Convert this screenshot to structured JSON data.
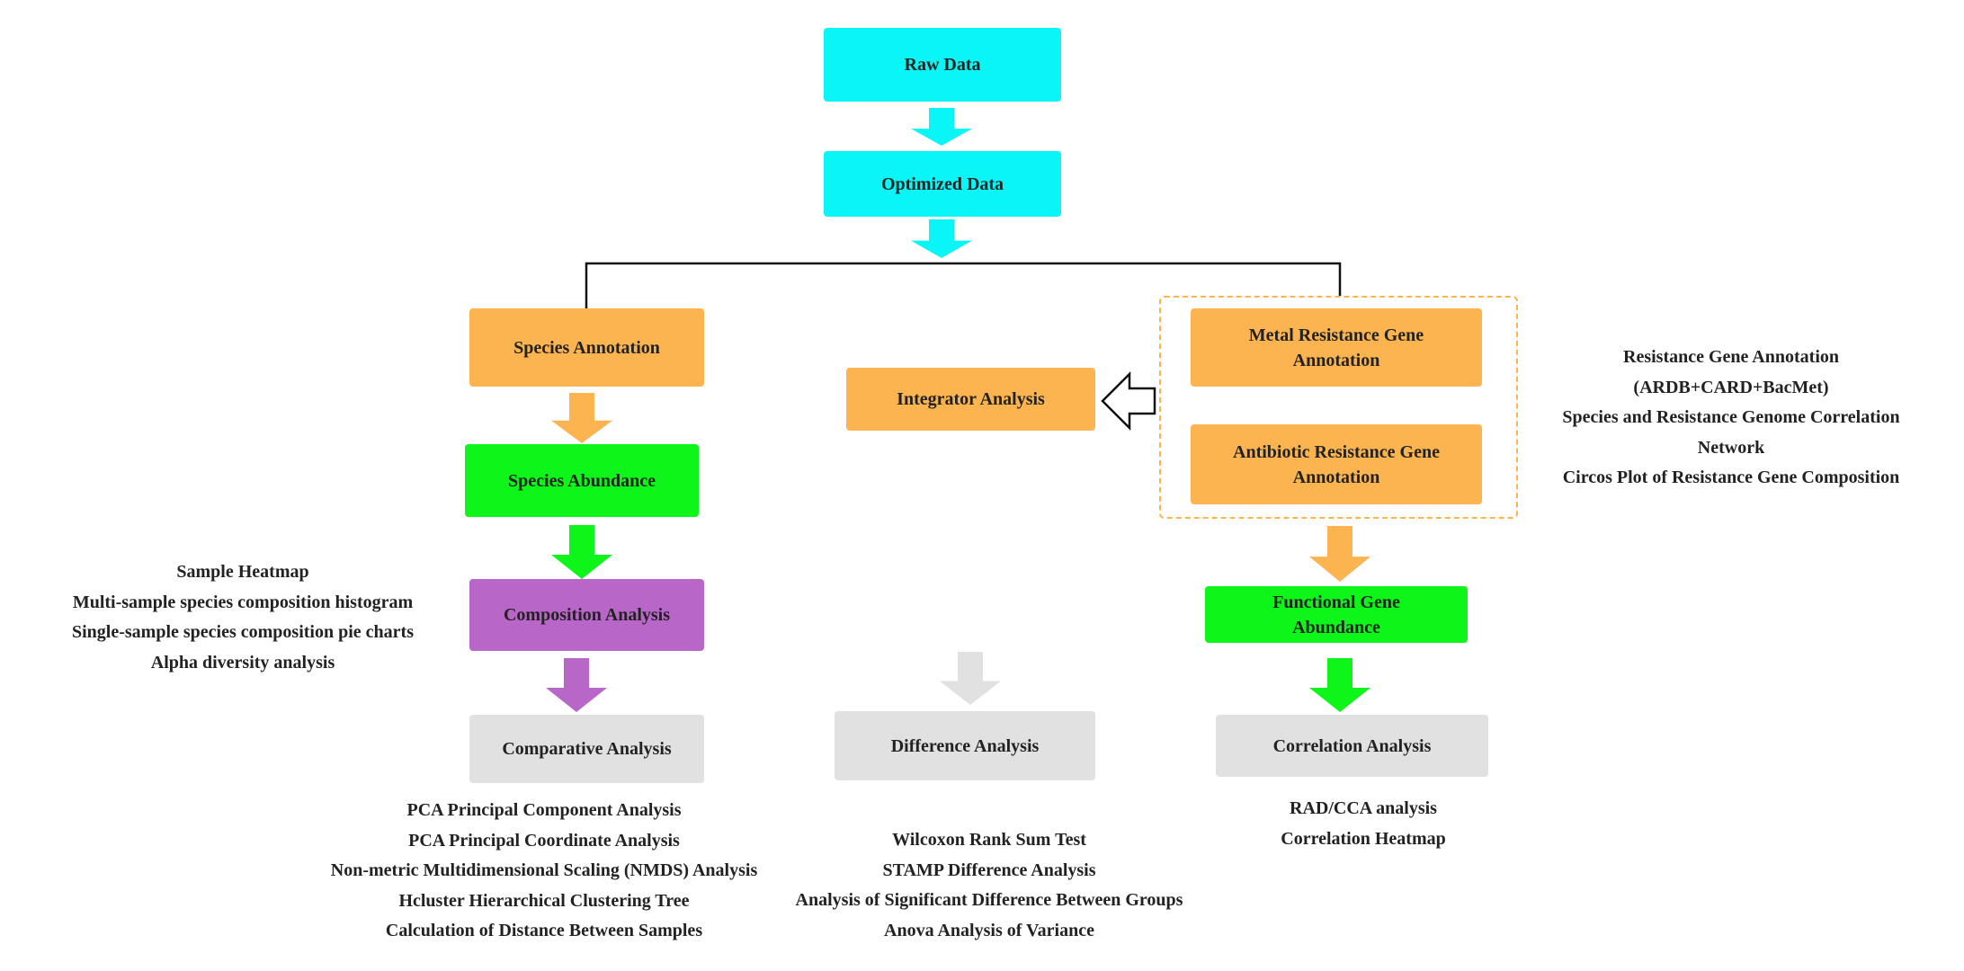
{
  "nodes": {
    "raw_data": "Raw Data",
    "optimized_data": "Optimized Data",
    "species_annotation": "Species Annotation",
    "species_abundance": "Species Abundance",
    "composition_analysis": "Composition Analysis",
    "comparative_analysis": "Comparative Analysis",
    "integrator_analysis": "Integrator Analysis",
    "metal_resistance": "Metal Resistance Gene Annotation",
    "antibiotic_resistance": "Antibiotic Resistance Gene Annotation",
    "functional_gene_abundance": "Functional Gene Abundance",
    "difference_analysis": "Difference Analysis",
    "correlation_analysis": "Correlation Analysis"
  },
  "notes": {
    "composition": [
      "Sample Heatmap",
      "Multi-sample species composition histogram",
      "Single-sample species composition pie charts",
      "Alpha diversity analysis"
    ],
    "resistance": [
      "Resistance Gene Annotation",
      "(ARDB+CARD+BacMet)",
      "Species and Resistance Genome Correlation",
      "Network",
      "Circos Plot of Resistance Gene Composition"
    ],
    "comparative": [
      "PCA Principal Component Analysis",
      "PCA Principal Coordinate Analysis",
      "Non-metric Multidimensional Scaling (NMDS) Analysis",
      "Hcluster Hierarchical Clustering Tree",
      "Calculation of Distance Between Samples"
    ],
    "difference": [
      "Wilcoxon Rank Sum Test",
      "STAMP Difference Analysis",
      "Analysis of Significant Difference Between Groups",
      "Anova Analysis of Variance"
    ],
    "correlation": [
      "RAD/CCA analysis",
      "Correlation Heatmap"
    ]
  },
  "colors": {
    "cyan": "#0af6f6",
    "orange": "#fbb450",
    "green": "#0ef51a",
    "purple": "#b966c9",
    "gray": "#e1e1e1"
  }
}
